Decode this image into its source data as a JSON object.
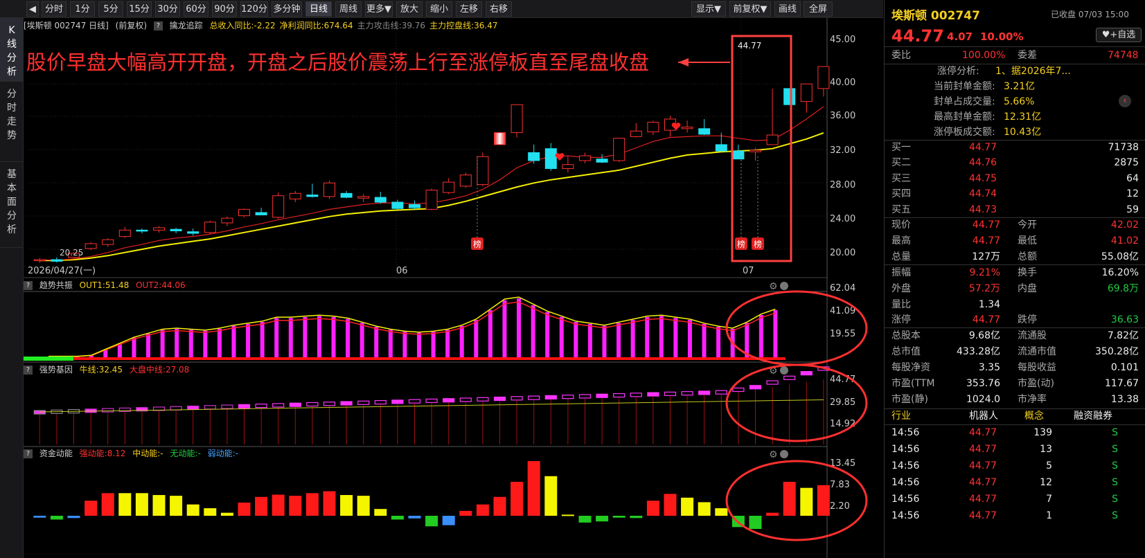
{
  "toolbar": {
    "back_icon": "back-arrow-icon",
    "periods": [
      "分时",
      "1分",
      "5分",
      "15分",
      "30分",
      "60分",
      "90分",
      "120分",
      "多分钟",
      "日线",
      "周线",
      "更多▼",
      "放大",
      "缩小",
      "左移",
      "右移"
    ],
    "active_period": "日线",
    "right_buttons": [
      "显示▼",
      "前复权▼",
      "画线",
      "全屏"
    ]
  },
  "leftnav": {
    "items": [
      {
        "label": [
          "K",
          "线",
          "分",
          "析"
        ],
        "active": true
      },
      {
        "label": [
          "分",
          "时",
          "走",
          "势"
        ],
        "active": false
      },
      {
        "label": [
          "基",
          "本",
          "面",
          "分",
          "析"
        ],
        "active": false
      }
    ]
  },
  "kline_header": {
    "stock": "[埃斯顿 002747 日线]",
    "adj": "(前复权)",
    "indicator": "擒龙追踪",
    "items": [
      {
        "text": "总收入同比:-2.22",
        "color": "#f5d020"
      },
      {
        "text": "净利润同比:674.64",
        "color": "#f5d020"
      },
      {
        "text": "主力攻击线:39.76",
        "color": "#888888"
      },
      {
        "text": "主力控盘线:36.47",
        "color": "#f5d020"
      }
    ]
  },
  "annotation": {
    "text": "股价早盘大幅高开开盘，开盘之后股价震荡上行至涨停板直至尾盘收盘",
    "color": "#ff3030"
  },
  "kline": {
    "y_labels": [
      "45.00",
      "40.00",
      "36.00",
      "32.00",
      "28.00",
      "24.00",
      "20.00"
    ],
    "low_label": "20.25",
    "high_label": "44.77",
    "x_labels": [
      {
        "text": "2026/04/27(一)"
      },
      {
        "text": "06"
      },
      {
        "text": "07"
      }
    ],
    "bang_label": "榜",
    "candles": [
      [
        20.5,
        20.8,
        20.2,
        20.6
      ],
      [
        20.6,
        20.9,
        20.25,
        20.4
      ],
      [
        20.9,
        21.5,
        20.8,
        21.4
      ],
      [
        22.0,
        22.8,
        21.8,
        22.6
      ],
      [
        22.5,
        23.3,
        22.2,
        23.1
      ],
      [
        23.5,
        24.7,
        23.3,
        24.3
      ],
      [
        24.3,
        24.5,
        23.9,
        24.2
      ],
      [
        24.3,
        24.8,
        24.0,
        24.6
      ],
      [
        24.4,
        24.6,
        23.9,
        24.2
      ],
      [
        24.1,
        24.5,
        23.6,
        23.9
      ],
      [
        24.0,
        25.5,
        23.8,
        25.3
      ],
      [
        25.2,
        26.0,
        24.8,
        25.8
      ],
      [
        26.1,
        27.0,
        25.9,
        26.9
      ],
      [
        26.5,
        27.1,
        26.2,
        26.2
      ],
      [
        25.9,
        29.0,
        25.7,
        28.6
      ],
      [
        28.2,
        29.2,
        27.8,
        28.9
      ],
      [
        28.7,
        30.1,
        28.4,
        28.5
      ],
      [
        28.5,
        30.5,
        28.2,
        30.2
      ],
      [
        28.9,
        29.2,
        28.3,
        28.4
      ],
      [
        28.3,
        28.8,
        27.8,
        28.5
      ],
      [
        28.4,
        29.1,
        27.6,
        27.8
      ],
      [
        27.8,
        28.1,
        26.9,
        27.0
      ],
      [
        27.5,
        28.0,
        26.9,
        27.1
      ],
      [
        26.9,
        29.5,
        26.8,
        29.3
      ],
      [
        29.0,
        30.8,
        28.8,
        30.3
      ],
      [
        29.8,
        31.5,
        29.6,
        31.2
      ],
      [
        30.0,
        34.0,
        29.8,
        33.5
      ],
      [
        35.0,
        36.5,
        35.0,
        36.5
      ],
      [
        36.5,
        40.0,
        35.9,
        40.0
      ],
      [
        34.0,
        35.0,
        32.6,
        33.0
      ],
      [
        34.5,
        35.2,
        31.7,
        32.0
      ],
      [
        32.0,
        33.5,
        31.5,
        32.5
      ],
      [
        33.0,
        34.0,
        32.7,
        33.6
      ],
      [
        33.2,
        33.8,
        32.7,
        32.8
      ],
      [
        33.0,
        35.5,
        32.8,
        35.8
      ],
      [
        36.0,
        37.7,
        35.9,
        36.7
      ],
      [
        36.6,
        38.0,
        36.2,
        37.8
      ],
      [
        36.8,
        38.6,
        36.0,
        38.2
      ],
      [
        37.0,
        38.0,
        36.5,
        37.2
      ],
      [
        37.0,
        38.2,
        36.2,
        36.3
      ],
      [
        35.0,
        36.5,
        34.2,
        34.2
      ],
      [
        34.2,
        35.0,
        33.2,
        33.2
      ],
      [
        34.1,
        34.6,
        33.0,
        34.3
      ],
      [
        35.0,
        42.0,
        35.0,
        36.2
      ],
      [
        42.02,
        42.02,
        41.02,
        40.0
      ],
      [
        40.4,
        42.6,
        39.0,
        42.6
      ],
      [
        42.02,
        44.77,
        41.02,
        44.77
      ]
    ],
    "ma_fast": [
      20.6,
      20.55,
      20.7,
      21.0,
      21.5,
      22.1,
      22.5,
      23.0,
      23.3,
      23.5,
      23.8,
      24.2,
      24.7,
      25.1,
      25.6,
      26.0,
      26.4,
      26.9,
      27.2,
      27.5,
      27.7,
      27.7,
      27.6,
      27.7,
      28.1,
      28.6,
      29.4,
      30.6,
      32.1,
      33.0,
      33.5,
      33.6,
      33.4,
      33.4,
      33.8,
      34.6,
      35.4,
      35.9,
      36.0,
      36.1,
      36.1,
      35.8,
      35.5,
      35.6,
      36.8,
      38.2,
      39.76
    ],
    "ma_slow": [
      20.5,
      20.5,
      20.6,
      20.8,
      21.1,
      21.5,
      21.9,
      22.3,
      22.6,
      22.9,
      23.2,
      23.6,
      24.0,
      24.4,
      24.8,
      25.2,
      25.6,
      26.0,
      26.3,
      26.5,
      26.7,
      26.8,
      26.9,
      27.0,
      27.4,
      27.9,
      28.5,
      29.1,
      29.7,
      30.2,
      30.6,
      30.9,
      31.2,
      31.5,
      31.8,
      32.3,
      32.8,
      33.3,
      33.7,
      33.9,
      34.1,
      34.2,
      34.3,
      34.5,
      35.1,
      35.7,
      36.47
    ]
  },
  "trend": {
    "header": {
      "name": "趋势共振",
      "out1": "OUT1:51.48",
      "out2": "OUT2:44.06"
    },
    "y_labels": [
      "62.04",
      "41.09",
      "19.55"
    ],
    "bars": [
      3,
      3,
      3,
      4,
      10,
      16,
      22,
      26,
      30,
      31,
      30,
      29,
      31,
      34,
      36,
      38,
      42,
      42,
      43,
      44,
      43,
      41,
      37,
      33,
      30,
      28,
      27,
      28,
      30,
      34,
      40,
      50,
      60,
      62,
      55,
      48,
      43,
      38,
      36,
      34,
      37,
      40,
      43,
      44,
      42,
      40,
      36,
      33,
      31,
      37,
      45,
      50
    ]
  },
  "strength": {
    "header": {
      "name": "强势基因",
      "bull": "牛线:32.45",
      "market": "大盘中线:27.08"
    },
    "y_labels": [
      "44.77",
      "29.85",
      "14.92"
    ]
  },
  "money": {
    "header": {
      "name": "资金动能",
      "strong": "强动能:8.12",
      "mid": "中动能:-",
      "none": "无动能:-",
      "weak": "弱动能:-"
    },
    "y_labels": [
      "13.45",
      "7.83",
      "2.20"
    ],
    "bars": [
      [
        0.5,
        "#3a8fff"
      ],
      [
        1,
        "#22cc22"
      ],
      [
        0.6,
        "#3a8fff"
      ],
      [
        4,
        "#ff1a1a"
      ],
      [
        6,
        "#ff1a1a"
      ],
      [
        6,
        "#f5f500"
      ],
      [
        6,
        "#f5f500"
      ],
      [
        5.5,
        "#f5f500"
      ],
      [
        5.3,
        "#f5f500"
      ],
      [
        3,
        "#f5f500"
      ],
      [
        2,
        "#f5f500"
      ],
      [
        0.8,
        "#f5f500"
      ],
      [
        3.5,
        "#ff1a1a"
      ],
      [
        5,
        "#ff1a1a"
      ],
      [
        5.6,
        "#ff1a1a"
      ],
      [
        5.3,
        "#ff1a1a"
      ],
      [
        6,
        "#ff1a1a"
      ],
      [
        6.5,
        "#ff1a1a"
      ],
      [
        5.5,
        "#f5f500"
      ],
      [
        5.3,
        "#f5f500"
      ],
      [
        1.8,
        "#f5f500"
      ],
      [
        1,
        "#22cc22"
      ],
      [
        0.7,
        "#3a8fff"
      ],
      [
        2.8,
        "#22cc22"
      ],
      [
        2.5,
        "#3a8fff"
      ],
      [
        1.3,
        "#ff1a1a"
      ],
      [
        3,
        "#ff1a1a"
      ],
      [
        5,
        "#ff1a1a"
      ],
      [
        9,
        "#ff1a1a"
      ],
      [
        14.5,
        "#ff1a1a"
      ],
      [
        10.5,
        "#f5f500"
      ],
      [
        0.3,
        "#f5f500"
      ],
      [
        1.8,
        "#22cc22"
      ],
      [
        1.5,
        "#22cc22"
      ],
      [
        0.5,
        "#22cc22"
      ],
      [
        0.6,
        "#22cc22"
      ],
      [
        4,
        "#ff1a1a"
      ],
      [
        5.8,
        "#ff1a1a"
      ],
      [
        4.8,
        "#f5f500"
      ],
      [
        3.6,
        "#f5f500"
      ],
      [
        2,
        "#f5f500"
      ],
      [
        3,
        "#22cc22"
      ],
      [
        3.5,
        "#22cc22"
      ],
      [
        0.8,
        "#ff1a1a"
      ],
      [
        9,
        "#ff1a1a"
      ],
      [
        7.4,
        "#f5f500"
      ],
      [
        8.12,
        "#ff1a1a"
      ]
    ]
  },
  "quote": {
    "name": "埃斯顿",
    "code": "002747",
    "status": "已收盘",
    "datetime": "07/03 15:00",
    "price": "44.77",
    "change": "4.07",
    "pct": "10.00%",
    "add_label": "+自选",
    "weibi_label": "委比",
    "weibi": "100.00%",
    "weicha_label": "委差",
    "weicha": "74748",
    "limit_info": [
      {
        "label": "涨停分析:",
        "value": "1、据2026年7..."
      },
      {
        "label": "当前封单金额:",
        "value": "3.21亿"
      },
      {
        "label": "封单占成交量:",
        "value": "5.66%"
      },
      {
        "label": "最高封单金额:",
        "value": "12.31亿"
      },
      {
        "label": "涨停板成交额:",
        "value": "10.43亿"
      }
    ],
    "bids": [
      {
        "label": "买一",
        "price": "44.77",
        "vol": "71738"
      },
      {
        "label": "买二",
        "price": "44.76",
        "vol": "2875"
      },
      {
        "label": "买三",
        "price": "44.75",
        "vol": "64"
      },
      {
        "label": "买四",
        "price": "44.74",
        "vol": "12"
      },
      {
        "label": "买五",
        "price": "44.73",
        "vol": "59"
      }
    ],
    "stats": [
      {
        "l1": "现价",
        "v1": "44.77",
        "c1": "#ff3333",
        "l2": "今开",
        "v2": "42.02",
        "c2": "#ff3333"
      },
      {
        "l1": "最高",
        "v1": "44.77",
        "c1": "#ff3333",
        "l2": "最低",
        "v2": "41.02",
        "c2": "#ff3333"
      },
      {
        "l1": "总量",
        "v1": "127万",
        "c1": "#eeeeee",
        "l2": "总额",
        "v2": "55.08亿",
        "c2": "#eeeeee"
      },
      {
        "l1": "振幅",
        "v1": "9.21%",
        "c1": "#ff3333",
        "l2": "换手",
        "v2": "16.20%",
        "c2": "#eeeeee"
      },
      {
        "l1": "外盘",
        "v1": "57.2万",
        "c1": "#ff3333",
        "l2": "内盘",
        "v2": "69.8万",
        "c2": "#22cc44"
      },
      {
        "l1": "量比",
        "v1": "1.34",
        "c1": "#eeeeee",
        "l2": "",
        "v2": "",
        "c2": "#eeeeee"
      },
      {
        "l1": "涨停",
        "v1": "44.77",
        "c1": "#ff3333",
        "l2": "跌停",
        "v2": "36.63",
        "c2": "#22cc44"
      },
      {
        "l1": "总股本",
        "v1": "9.68亿",
        "c1": "#eeeeee",
        "l2": "流通股",
        "v2": "7.82亿",
        "c2": "#eeeeee"
      },
      {
        "l1": "总市值",
        "v1": "433.28亿",
        "c1": "#eeeeee",
        "l2": "流通市值",
        "v2": "350.28亿",
        "c2": "#eeeeee"
      },
      {
        "l1": "每股净资",
        "v1": "3.35",
        "c1": "#eeeeee",
        "l2": "每股收益",
        "v2": "0.101",
        "c2": "#eeeeee"
      },
      {
        "l1": "市盈(TTM",
        "v1": "353.76",
        "c1": "#eeeeee",
        "l2": "市盈(动)",
        "v2": "117.67",
        "c2": "#eeeeee"
      },
      {
        "l1": "市盈(静)",
        "v1": "1024.0",
        "c1": "#eeeeee",
        "l2": "市净率",
        "v2": "13.38",
        "c2": "#eeeeee"
      }
    ],
    "tags": [
      "行业",
      "机器人",
      "概念",
      "融资融券"
    ],
    "ticks": [
      {
        "time": "14:56",
        "price": "44.77",
        "vol": "139",
        "bs": "S"
      },
      {
        "time": "14:56",
        "price": "44.77",
        "vol": "13",
        "bs": "S"
      },
      {
        "time": "14:56",
        "price": "44.77",
        "vol": "5",
        "bs": "S"
      },
      {
        "time": "14:56",
        "price": "44.77",
        "vol": "12",
        "bs": "S"
      },
      {
        "time": "14:56",
        "price": "44.77",
        "vol": "7",
        "bs": "S"
      },
      {
        "time": "14:56",
        "price": "44.77",
        "vol": "1",
        "bs": "S"
      }
    ]
  }
}
